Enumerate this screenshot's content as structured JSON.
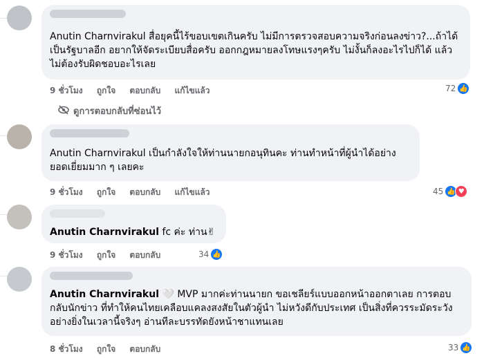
{
  "comments": [
    {
      "tag": "Anutin Charnvirakul",
      "text": " สื่อยุคนี้ไร้ขอบเขตเกินครับ ไม่มีการตรวจสอบความจริงก่อนลงข่าว?...ถ้าได้เป็นรัฐบาลอีก อยากให้จัดระเบียบสื่อครับ ออกกฎหมายลงโทษแรงๆครับ ไม่งั้นก็ลงอะไรไปก็ได้ แล้วไม่ต้องรับผิดชอบอะไรเลย",
      "time": "9 ชั่วโมง",
      "like": "ถูกใจ",
      "reply": "ตอบกลับ",
      "edited": "แก้ไขแล้ว",
      "reactions": "72"
    },
    {
      "tag": "Anutin Charnvirakul",
      "text": " เป็นกำลังใจให้ท่านนายกอนุทินคะ ท่านทำหน้าที่ผู้นำได้อย่างยอดเยี่ยมมาก ๆ เลยคะ",
      "time": "9 ชั่วโมง",
      "like": "ถูกใจ",
      "reply": "ตอบกลับ",
      "edited": "แก้ไขแล้ว",
      "reactions": "45"
    },
    {
      "tag": "Anutin Charnvirakul",
      "text": " fc ค่ะ ท่าน✌",
      "time": "9 ชั่วโมง",
      "like": "ถูกใจ",
      "reply": "ตอบกลับ",
      "reactions": "34"
    },
    {
      "tag": "Anutin Charnvirakul",
      "text": " 🤍 MVP มากค่ะท่านนายก ขอเชลียร์แบบออกหน้าออกตาเลย การตอบกลับนักข่าว ที่ทำให้คนไทยเคลือบแคลงสงสัยในตัวผู้นำ ไม่หวังดีกับประเทศ เป็นสิ่งที่ควรระมัดระวังอย่างยิ่งในเวลานี้จริงๆ อ่านทีละบรรทัดยังหน้าชาแทนเลย",
      "time": "8 ชั่วโมง",
      "like": "ถูกใจ",
      "reply": "ตอบกลับ",
      "reactions": "33"
    }
  ],
  "hidden_replies": "ดูการตอบกลับที่ซ่อนไว้",
  "icons": {
    "like": "like-icon",
    "love": "love-icon",
    "hidden": "eye-slash-icon"
  },
  "colors": {
    "bubble": "#f0f2f5",
    "like_blue": "#1877f2",
    "love_red": "#f33e58",
    "muted": "#65676b"
  }
}
